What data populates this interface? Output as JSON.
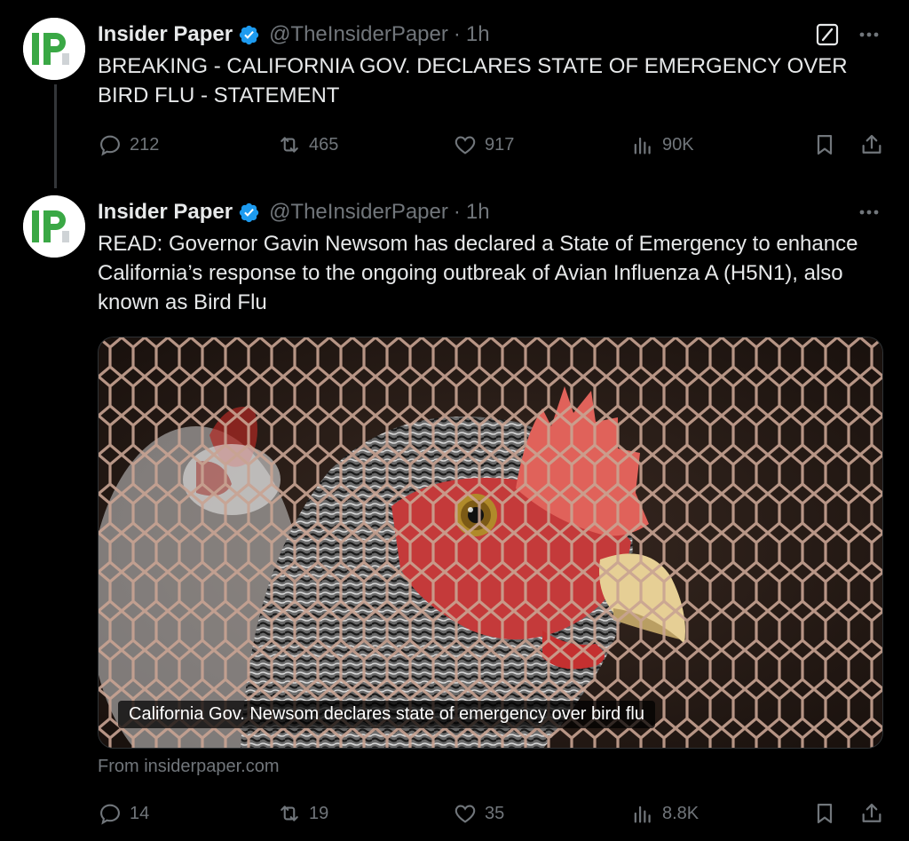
{
  "tweets": [
    {
      "author": "Insider Paper",
      "handle": "@TheInsiderPaper",
      "separator": "·",
      "time": "1h",
      "avatar_text": "IP",
      "text": "BREAKING - CALIFORNIA GOV. DECLARES STATE OF EMERGENCY OVER BIRD FLU - STATEMENT",
      "stats": {
        "replies": "212",
        "retweets": "465",
        "likes": "917",
        "views": "90K"
      }
    },
    {
      "author": "Insider Paper",
      "handle": "@TheInsiderPaper",
      "separator": "·",
      "time": "1h",
      "avatar_text": "IP",
      "text": "READ: Governor Gavin Newsom has declared a State of Emergency to enhance California’s response to the ongoing outbreak of Avian Influenza A (H5N1), also known as Bird Flu",
      "card": {
        "caption": "California Gov. Newsom declares state of emergency over bird flu",
        "source": "From insiderpaper.com"
      },
      "stats": {
        "replies": "14",
        "retweets": "19",
        "likes": "35",
        "views": "8.8K"
      }
    }
  ],
  "icons": {
    "verified": "verified-badge-icon",
    "grok": "grok-icon",
    "more": "more-options-icon",
    "reply": "reply-icon",
    "retweet": "retweet-icon",
    "like": "heart-icon",
    "views": "views-icon",
    "bookmark": "bookmark-icon",
    "share": "share-icon"
  },
  "colors": {
    "background": "#000000",
    "text": "#e7e9ea",
    "muted": "#71767b",
    "verified": "#1d9bf0",
    "avatar_green": "#3aa845"
  }
}
